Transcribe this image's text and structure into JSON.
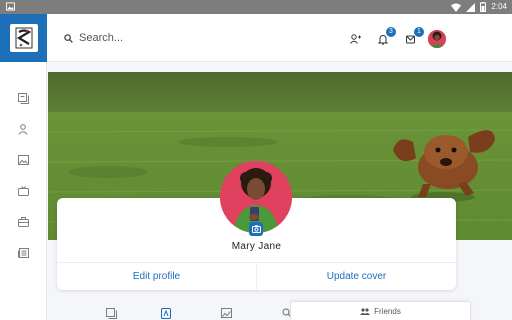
{
  "status_bar": {
    "time": "2:04"
  },
  "header": {
    "search_placeholder": "Search...",
    "notifications_count": "3",
    "messages_count": "1"
  },
  "sidebar": {
    "items": [
      {
        "icon": "pages-icon"
      },
      {
        "icon": "user-icon"
      },
      {
        "icon": "image-icon"
      },
      {
        "icon": "tv-icon"
      },
      {
        "icon": "briefcase-icon"
      },
      {
        "icon": "newspaper-icon"
      }
    ]
  },
  "profile": {
    "name": "Mary Jane",
    "edit_profile_label": "Edit profile",
    "update_cover_label": "Update cover"
  },
  "tabs": [
    {
      "icon": "posts-icon"
    },
    {
      "icon": "about-icon"
    },
    {
      "icon": "photos-icon"
    },
    {
      "icon": "search-icon"
    }
  ],
  "friends_bar": {
    "label": "Friends"
  },
  "colors": {
    "primary": "#1d6fb8",
    "status_bar": "#7d7d7d",
    "avatar_bg": "#e0415e"
  }
}
